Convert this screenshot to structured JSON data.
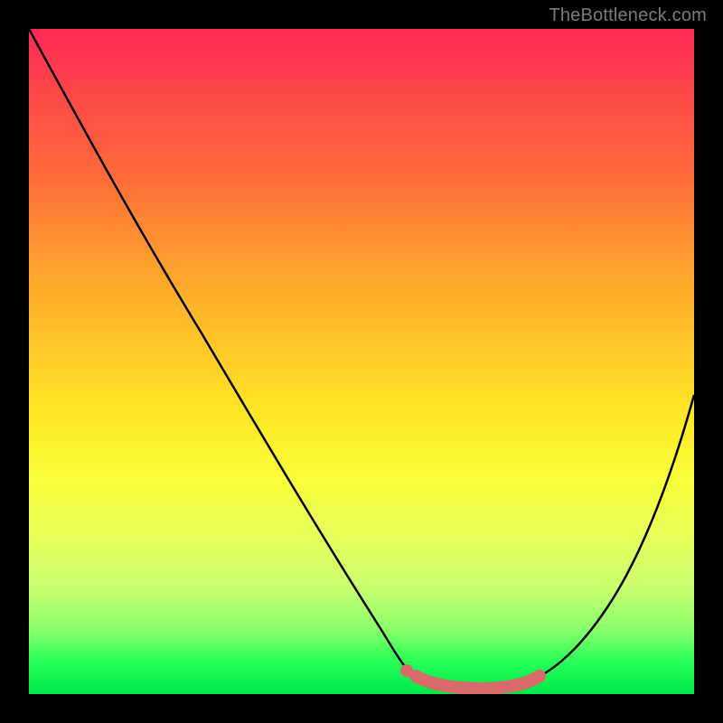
{
  "brand": {
    "label": "TheBottleneck.com"
  },
  "chart_data": {
    "type": "line",
    "title": "",
    "xlabel": "",
    "ylabel": "",
    "xlim": [
      0,
      100
    ],
    "ylim": [
      0,
      100
    ],
    "grid": false,
    "legend": false,
    "series": [
      {
        "name": "bottleneck-curve",
        "x": [
          0,
          6,
          12,
          18,
          24,
          30,
          36,
          42,
          48,
          54,
          58,
          62,
          66,
          70,
          75,
          80,
          85,
          90,
          95,
          100
        ],
        "y": [
          100,
          90,
          80,
          70,
          60,
          50,
          41,
          32,
          23,
          13,
          6,
          2,
          1,
          1,
          3,
          8,
          15,
          24,
          34,
          45
        ]
      },
      {
        "name": "optimal-band",
        "x": [
          56,
          60,
          64,
          68,
          72,
          76
        ],
        "y": [
          4,
          2,
          1,
          1,
          2,
          4
        ]
      }
    ],
    "annotations": [],
    "colors": {
      "curve": "#000000",
      "band": "#d86a6a",
      "band_dot": "#d86a6a",
      "bg_top": "#ff2a57",
      "bg_mid": "#ffe726",
      "bg_bottom": "#00e74a"
    }
  }
}
